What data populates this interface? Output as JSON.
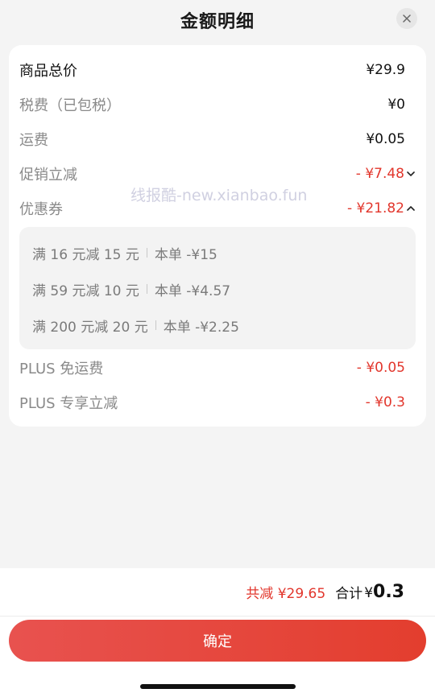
{
  "header": {
    "title": "金额明细",
    "close_icon": "close-icon"
  },
  "breakdown": {
    "items_total": {
      "label": "商品总价",
      "value": "¥29.9"
    },
    "tax": {
      "label": "税费（已包税）",
      "value": "¥0"
    },
    "shipping": {
      "label": "运费",
      "value": "¥0.05"
    },
    "promo": {
      "label": "促销立减",
      "value": "- ¥7.48",
      "chevron": "chevron-down-icon"
    },
    "coupon": {
      "label": "优惠券",
      "value": "- ¥21.82",
      "chevron": "chevron-up-icon"
    },
    "coupon_details": [
      {
        "rule": "满 16 元减 15 元",
        "applied": "本单 -¥15"
      },
      {
        "rule": "满 59 元减 10 元",
        "applied": "本单 -¥4.57"
      },
      {
        "rule": "满 200 元减 20 元",
        "applied": "本单 -¥2.25"
      }
    ],
    "plus_shipping": {
      "label": "PLUS 免运费",
      "value": "- ¥0.05"
    },
    "plus_discount": {
      "label": "PLUS 专享立减",
      "value": "- ¥0.3"
    }
  },
  "watermark": "线报酷-new.xianbao.fun",
  "summary": {
    "saved": "共减 ¥29.65",
    "total_label": "合计",
    "currency": "¥",
    "total_value": "0.3"
  },
  "confirm_label": "确定",
  "colors": {
    "accent_red": "#e2362c",
    "button_start": "#e8524f",
    "button_end": "#e33e2e"
  }
}
